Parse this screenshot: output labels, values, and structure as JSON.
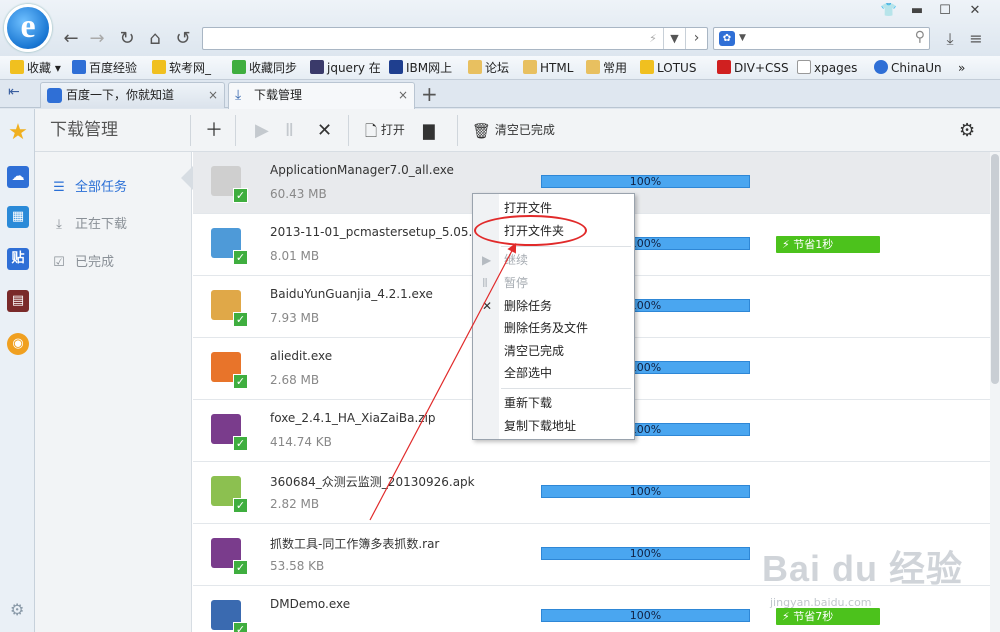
{
  "browser": {
    "logo_letter": "e",
    "search_engine_icon": "baidu-paw-icon",
    "bookmarks": [
      {
        "label": "收藏",
        "color": "#f0c020"
      },
      {
        "label": "百度经验",
        "color": "#2f6fd6"
      },
      {
        "label": "软考网_",
        "color": "#f0c020"
      },
      {
        "label": "收藏同步",
        "color": "#3fae3f"
      },
      {
        "label": "jquery 在",
        "color": "#3a3a6a"
      },
      {
        "label": "IBM网上",
        "color": "#1f3f8f"
      },
      {
        "label": "论坛",
        "color": "#e8c060"
      },
      {
        "label": "HTML",
        "color": "#e8c060"
      },
      {
        "label": "常用",
        "color": "#e8c060"
      },
      {
        "label": "LOTUS",
        "color": "#f0c020"
      },
      {
        "label": "DIV+CSS",
        "color": "#d02020"
      },
      {
        "label": "xpages",
        "color": "#ffffff"
      },
      {
        "label": "ChinaUn",
        "color": "#2f6fd6"
      }
    ],
    "bookmarks_more": "»",
    "tabs": [
      {
        "label": "百度一下，你就知道",
        "close": "×"
      },
      {
        "label": "下载管理",
        "close": "×"
      }
    ],
    "new_tab": "+"
  },
  "download_manager": {
    "title": "下载管理",
    "toolbar": {
      "open_label": "打开",
      "clear_done_label": "清空已完成"
    },
    "sidebar": [
      {
        "label": "全部任务",
        "icon": "list-icon",
        "active": true
      },
      {
        "label": "正在下载",
        "icon": "download-icon",
        "active": false
      },
      {
        "label": "已完成",
        "icon": "checkbox-icon",
        "active": false
      }
    ],
    "items": [
      {
        "name": "ApplicationManager7.0_all.exe",
        "size": "60.43 MB",
        "progress": "100%",
        "badge": "",
        "icon_color": "#cfcfcf"
      },
      {
        "name": "2013-11-01_pcmastersetup_5.05.exe",
        "size": "8.01 MB",
        "progress": "100%",
        "badge": "节省1秒",
        "icon_color": "#4e9ad8"
      },
      {
        "name": "BaiduYunGuanjia_4.2.1.exe",
        "size": "7.93 MB",
        "progress": "100%",
        "badge": "",
        "icon_color": "#e0a848"
      },
      {
        "name": "aliedit.exe",
        "size": "2.68 MB",
        "progress": "100%",
        "badge": "",
        "icon_color": "#e8742a"
      },
      {
        "name": "foxe_2.4.1_HA_XiaZaiBa.zip",
        "size": "414.74 KB",
        "progress": "100%",
        "badge": "",
        "icon_color": "#7a3c8c"
      },
      {
        "name": "360684_众测云监测_20130926.apk",
        "size": "2.82 MB",
        "progress": "100%",
        "badge": "",
        "icon_color": "#8cc050"
      },
      {
        "name": "抓数工具-同工作簿多表抓数.rar",
        "size": "53.58 KB",
        "progress": "100%",
        "badge": "",
        "icon_color": "#7a3c8c"
      },
      {
        "name": "DMDemo.exe",
        "size": "",
        "progress": "100%",
        "badge": "节省7秒",
        "icon_color": "#3a6ab0"
      }
    ]
  },
  "context_menu": {
    "items": [
      {
        "label": "打开文件",
        "disabled": false,
        "glyph": ""
      },
      {
        "label": "打开文件夹",
        "disabled": false,
        "glyph": ""
      },
      {
        "label": "继续",
        "disabled": true,
        "glyph": "▶"
      },
      {
        "label": "暂停",
        "disabled": true,
        "glyph": "Ⅱ"
      },
      {
        "label": "删除任务",
        "disabled": false,
        "glyph": "✕"
      },
      {
        "label": "删除任务及文件",
        "disabled": false,
        "glyph": ""
      },
      {
        "label": "清空已完成",
        "disabled": false,
        "glyph": ""
      },
      {
        "label": "全部选中",
        "disabled": false,
        "glyph": ""
      },
      {
        "label": "重新下载",
        "disabled": false,
        "glyph": ""
      },
      {
        "label": "复制下载地址",
        "disabled": false,
        "glyph": ""
      }
    ],
    "highlight_color": "#e12a2a"
  },
  "watermark": {
    "text": "Bai du 经验",
    "sub": "jingyan.baidu.com"
  }
}
